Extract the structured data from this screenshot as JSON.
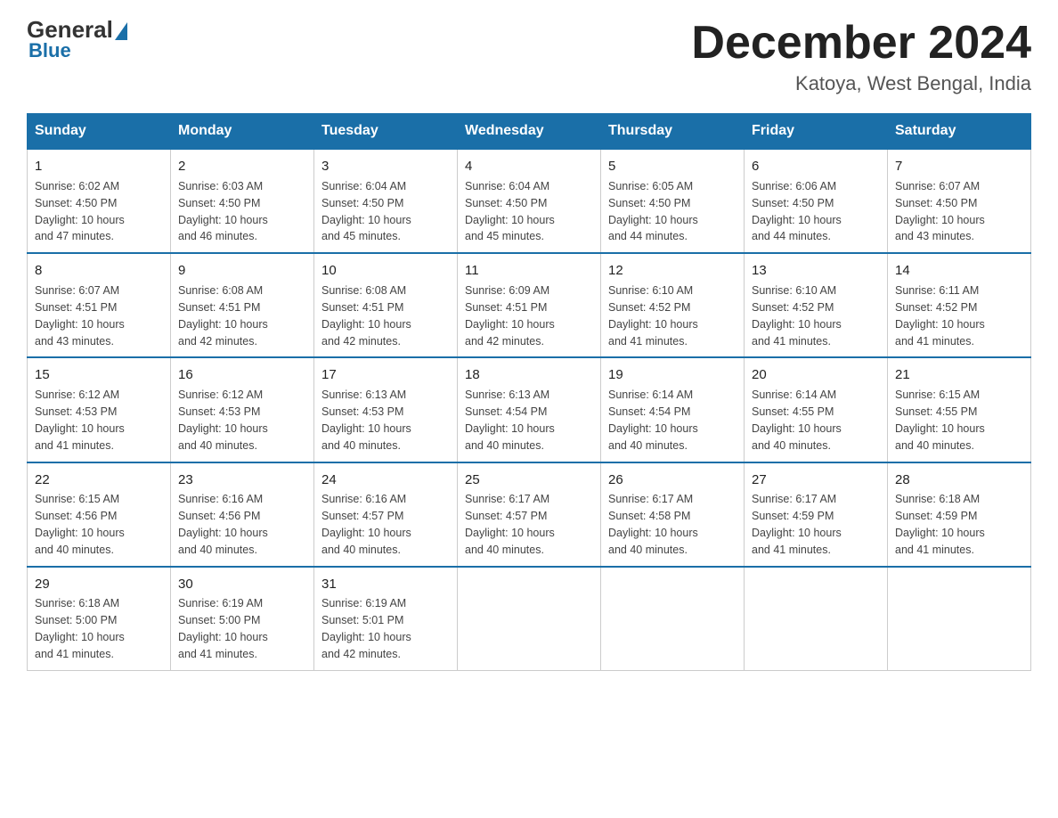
{
  "header": {
    "logo_general": "General",
    "logo_blue": "Blue",
    "month_title": "December 2024",
    "location": "Katoya, West Bengal, India"
  },
  "days_of_week": [
    "Sunday",
    "Monday",
    "Tuesday",
    "Wednesday",
    "Thursday",
    "Friday",
    "Saturday"
  ],
  "weeks": [
    [
      {
        "day": "1",
        "sunrise": "6:02 AM",
        "sunset": "4:50 PM",
        "daylight": "10 hours and 47 minutes."
      },
      {
        "day": "2",
        "sunrise": "6:03 AM",
        "sunset": "4:50 PM",
        "daylight": "10 hours and 46 minutes."
      },
      {
        "day": "3",
        "sunrise": "6:04 AM",
        "sunset": "4:50 PM",
        "daylight": "10 hours and 45 minutes."
      },
      {
        "day": "4",
        "sunrise": "6:04 AM",
        "sunset": "4:50 PM",
        "daylight": "10 hours and 45 minutes."
      },
      {
        "day": "5",
        "sunrise": "6:05 AM",
        "sunset": "4:50 PM",
        "daylight": "10 hours and 44 minutes."
      },
      {
        "day": "6",
        "sunrise": "6:06 AM",
        "sunset": "4:50 PM",
        "daylight": "10 hours and 44 minutes."
      },
      {
        "day": "7",
        "sunrise": "6:07 AM",
        "sunset": "4:50 PM",
        "daylight": "10 hours and 43 minutes."
      }
    ],
    [
      {
        "day": "8",
        "sunrise": "6:07 AM",
        "sunset": "4:51 PM",
        "daylight": "10 hours and 43 minutes."
      },
      {
        "day": "9",
        "sunrise": "6:08 AM",
        "sunset": "4:51 PM",
        "daylight": "10 hours and 42 minutes."
      },
      {
        "day": "10",
        "sunrise": "6:08 AM",
        "sunset": "4:51 PM",
        "daylight": "10 hours and 42 minutes."
      },
      {
        "day": "11",
        "sunrise": "6:09 AM",
        "sunset": "4:51 PM",
        "daylight": "10 hours and 42 minutes."
      },
      {
        "day": "12",
        "sunrise": "6:10 AM",
        "sunset": "4:52 PM",
        "daylight": "10 hours and 41 minutes."
      },
      {
        "day": "13",
        "sunrise": "6:10 AM",
        "sunset": "4:52 PM",
        "daylight": "10 hours and 41 minutes."
      },
      {
        "day": "14",
        "sunrise": "6:11 AM",
        "sunset": "4:52 PM",
        "daylight": "10 hours and 41 minutes."
      }
    ],
    [
      {
        "day": "15",
        "sunrise": "6:12 AM",
        "sunset": "4:53 PM",
        "daylight": "10 hours and 41 minutes."
      },
      {
        "day": "16",
        "sunrise": "6:12 AM",
        "sunset": "4:53 PM",
        "daylight": "10 hours and 40 minutes."
      },
      {
        "day": "17",
        "sunrise": "6:13 AM",
        "sunset": "4:53 PM",
        "daylight": "10 hours and 40 minutes."
      },
      {
        "day": "18",
        "sunrise": "6:13 AM",
        "sunset": "4:54 PM",
        "daylight": "10 hours and 40 minutes."
      },
      {
        "day": "19",
        "sunrise": "6:14 AM",
        "sunset": "4:54 PM",
        "daylight": "10 hours and 40 minutes."
      },
      {
        "day": "20",
        "sunrise": "6:14 AM",
        "sunset": "4:55 PM",
        "daylight": "10 hours and 40 minutes."
      },
      {
        "day": "21",
        "sunrise": "6:15 AM",
        "sunset": "4:55 PM",
        "daylight": "10 hours and 40 minutes."
      }
    ],
    [
      {
        "day": "22",
        "sunrise": "6:15 AM",
        "sunset": "4:56 PM",
        "daylight": "10 hours and 40 minutes."
      },
      {
        "day": "23",
        "sunrise": "6:16 AM",
        "sunset": "4:56 PM",
        "daylight": "10 hours and 40 minutes."
      },
      {
        "day": "24",
        "sunrise": "6:16 AM",
        "sunset": "4:57 PM",
        "daylight": "10 hours and 40 minutes."
      },
      {
        "day": "25",
        "sunrise": "6:17 AM",
        "sunset": "4:57 PM",
        "daylight": "10 hours and 40 minutes."
      },
      {
        "day": "26",
        "sunrise": "6:17 AM",
        "sunset": "4:58 PM",
        "daylight": "10 hours and 40 minutes."
      },
      {
        "day": "27",
        "sunrise": "6:17 AM",
        "sunset": "4:59 PM",
        "daylight": "10 hours and 41 minutes."
      },
      {
        "day": "28",
        "sunrise": "6:18 AM",
        "sunset": "4:59 PM",
        "daylight": "10 hours and 41 minutes."
      }
    ],
    [
      {
        "day": "29",
        "sunrise": "6:18 AM",
        "sunset": "5:00 PM",
        "daylight": "10 hours and 41 minutes."
      },
      {
        "day": "30",
        "sunrise": "6:19 AM",
        "sunset": "5:00 PM",
        "daylight": "10 hours and 41 minutes."
      },
      {
        "day": "31",
        "sunrise": "6:19 AM",
        "sunset": "5:01 PM",
        "daylight": "10 hours and 42 minutes."
      },
      null,
      null,
      null,
      null
    ]
  ],
  "labels": {
    "sunrise": "Sunrise:",
    "sunset": "Sunset:",
    "daylight": "Daylight:"
  }
}
